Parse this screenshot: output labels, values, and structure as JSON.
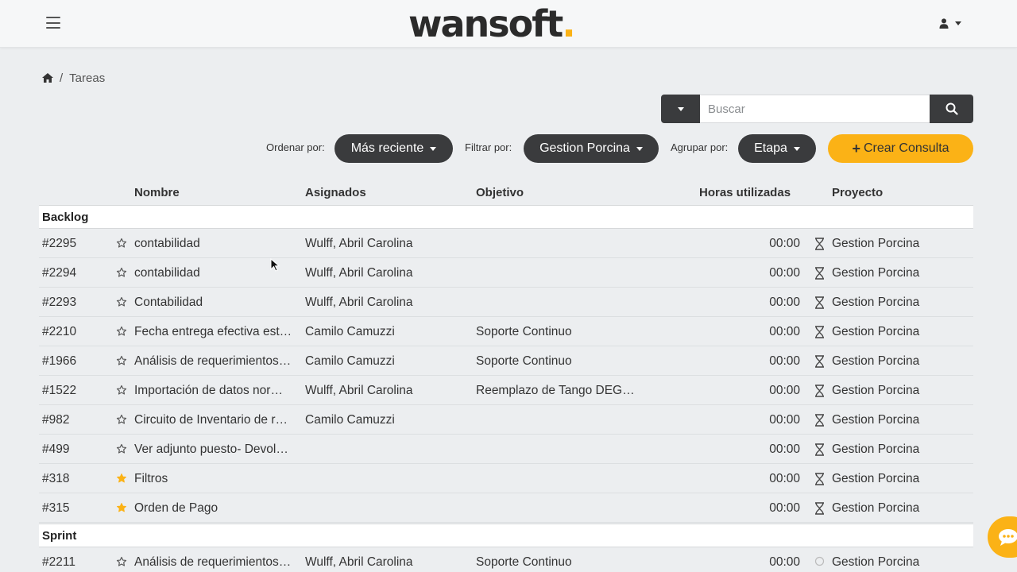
{
  "header": {
    "logo_text": "wansoft",
    "logo_dot": ".",
    "accent": "#fbb216"
  },
  "breadcrumb": {
    "current": "Tareas"
  },
  "search": {
    "placeholder": "Buscar"
  },
  "toolbar": {
    "sort_label": "Ordenar por:",
    "sort_value": "Más reciente",
    "filter_label": "Filtrar por:",
    "filter_value": "Gestion Porcina",
    "group_label": "Agrupar por:",
    "group_value": "Etapa",
    "create_label": "Crear Consulta"
  },
  "columns": {
    "name": "Nombre",
    "assigned": "Asignados",
    "objective": "Objetivo",
    "hours": "Horas utilizadas",
    "project": "Proyecto"
  },
  "groups": [
    {
      "label": "Backlog",
      "rows": [
        {
          "id": "#2295",
          "starred": false,
          "name": "contabilidad",
          "assigned": "Wulff, Abril Carolina",
          "objective": "",
          "hours": "00:00",
          "project": "Gestion Porcina"
        },
        {
          "id": "#2294",
          "starred": false,
          "name": "contabilidad",
          "assigned": "Wulff, Abril Carolina",
          "objective": "",
          "hours": "00:00",
          "project": "Gestion Porcina"
        },
        {
          "id": "#2293",
          "starred": false,
          "name": "Contabilidad",
          "assigned": "Wulff, Abril Carolina",
          "objective": "",
          "hours": "00:00",
          "project": "Gestion Porcina"
        },
        {
          "id": "#2210",
          "starred": false,
          "name": "Fecha entrega efectiva est…",
          "assigned": "Camilo Camuzzi",
          "objective": "Soporte Continuo",
          "hours": "00:00",
          "project": "Gestion Porcina"
        },
        {
          "id": "#1966",
          "starred": false,
          "name": "Análisis de requerimientos…",
          "assigned": "Camilo Camuzzi",
          "objective": "Soporte Continuo",
          "hours": "00:00",
          "project": "Gestion Porcina"
        },
        {
          "id": "#1522",
          "starred": false,
          "name": "Importación de datos nor…",
          "assigned": "Wulff, Abril Carolina",
          "objective": "Reemplazo de Tango DEG…",
          "hours": "00:00",
          "project": "Gestion Porcina"
        },
        {
          "id": "#982",
          "starred": false,
          "name": "Circuito de Inventario de r…",
          "assigned": "Camilo Camuzzi",
          "objective": "",
          "hours": "00:00",
          "project": "Gestion Porcina"
        },
        {
          "id": "#499",
          "starred": false,
          "name": "Ver adjunto puesto- Devol…",
          "assigned": "",
          "objective": "",
          "hours": "00:00",
          "project": "Gestion Porcina"
        },
        {
          "id": "#318",
          "starred": true,
          "name": "Filtros",
          "assigned": "",
          "objective": "",
          "hours": "00:00",
          "project": "Gestion Porcina"
        },
        {
          "id": "#315",
          "starred": true,
          "name": "Orden de Pago",
          "assigned": "",
          "objective": "",
          "hours": "00:00",
          "project": "Gestion Porcina"
        }
      ]
    },
    {
      "label": "Sprint",
      "rows": [
        {
          "id": "#2211",
          "starred": false,
          "name": "Análisis de requerimientos…",
          "assigned": "Wulff, Abril Carolina",
          "objective": "Soporte Continuo",
          "hours": "00:00",
          "project": "Gestion Porcina"
        }
      ]
    }
  ]
}
